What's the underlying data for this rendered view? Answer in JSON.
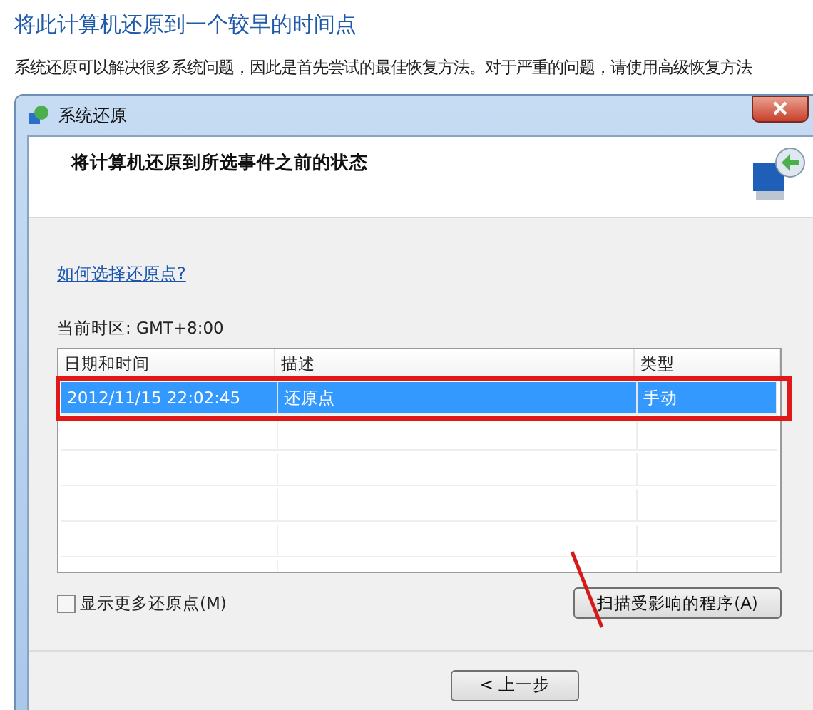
{
  "page": {
    "title": "将此计算机还原到一个较早的时间点",
    "description": "系统还原可以解决很多系统问题，因此是首先尝试的最佳恢复方法。对于严重的问题，请使用高级恢复方法"
  },
  "dialog": {
    "title": "系统还原",
    "heading": "将计算机还原到所选事件之前的状态",
    "help_link": "如何选择还原点?",
    "timezone_label": "当前时区: GMT+8:00",
    "table": {
      "columns": [
        "日期和时间",
        "描述",
        "类型"
      ],
      "rows": [
        {
          "cells": [
            "2012/11/15 22:02:45",
            "还原点",
            "手动"
          ],
          "selected": true
        }
      ]
    },
    "show_more": {
      "label": "显示更多还原点(M)",
      "checked": false
    },
    "scan_button": "扫描受影响的程序(A)",
    "back_button": "< 上一步"
  }
}
